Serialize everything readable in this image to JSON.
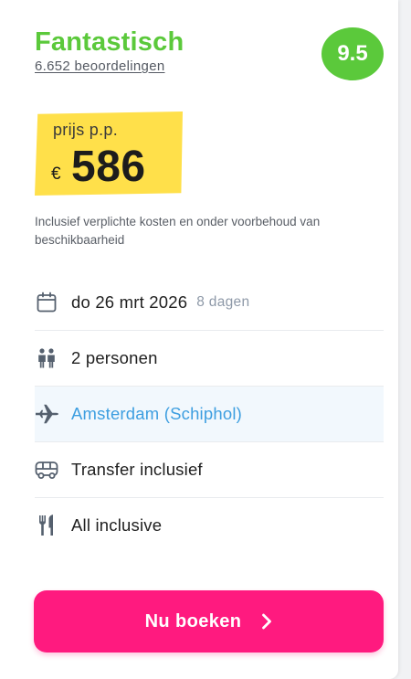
{
  "rating": {
    "label": "Fantastisch",
    "reviews": "6.652 beoordelingen",
    "score": "9.5"
  },
  "price": {
    "label": "prijs p.p.",
    "currency": "€",
    "amount": "586"
  },
  "disclaimer": "Inclusief verplichte kosten en onder voorbehoud van beschikbaarheid",
  "details": {
    "date": {
      "text": "do 26 mrt 2026",
      "duration": "8 dagen",
      "icon": "calendar-icon"
    },
    "persons": {
      "text": "2 personen",
      "icon": "persons-icon"
    },
    "departure": {
      "text": "Amsterdam (Schiphol)",
      "icon": "airplane-icon"
    },
    "transfer": {
      "text": "Transfer inclusief",
      "icon": "bus-icon"
    },
    "board": {
      "text": "All inclusive",
      "icon": "fork-knife-icon"
    }
  },
  "book_button": {
    "label": "Nu boeken",
    "icon": "chevron-right-icon"
  },
  "colors": {
    "rating_green": "#5bc93b",
    "price_yellow": "#ffe04a",
    "link_blue": "#3d9ee0",
    "cta_pink": "#ff1a7f"
  }
}
